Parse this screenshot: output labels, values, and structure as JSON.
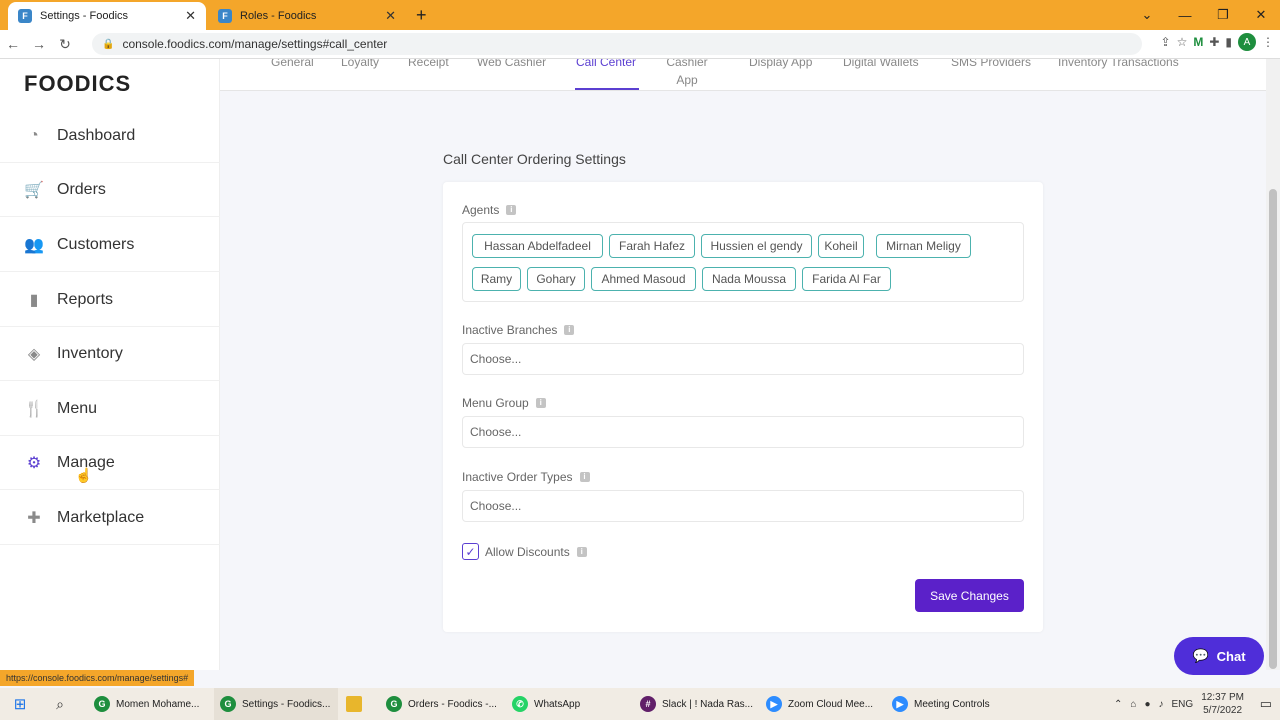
{
  "browser": {
    "tabs": [
      {
        "title": "Settings - Foodics",
        "active": true
      },
      {
        "title": "Roles - Foodics",
        "active": false
      }
    ],
    "url": "console.foodics.com/manage/settings#call_center",
    "status_url": "https://console.foodics.com/manage/settings#",
    "profile_initial": "A"
  },
  "sidebar": {
    "logo": "FOODICS",
    "items": [
      {
        "label": "Dashboard",
        "icon": "gauge-icon"
      },
      {
        "label": "Orders",
        "icon": "cart-icon"
      },
      {
        "label": "Customers",
        "icon": "users-icon"
      },
      {
        "label": "Reports",
        "icon": "bar-chart-icon"
      },
      {
        "label": "Inventory",
        "icon": "layers-icon"
      },
      {
        "label": "Menu",
        "icon": "utensils-icon"
      },
      {
        "label": "Manage",
        "icon": "gear-icon"
      },
      {
        "label": "Marketplace",
        "icon": "puzzle-icon"
      }
    ]
  },
  "topnav": {
    "tabs": [
      "General",
      "Loyalty",
      "Receipt",
      "Web Cashier",
      "Call Center",
      "Cashier App",
      "Display App",
      "Digital Wallets",
      "SMS Providers",
      "Inventory Transactions"
    ],
    "active": "Call Center"
  },
  "page": {
    "title": "Call Center Ordering Settings",
    "agents_label": "Agents",
    "agents": [
      "Hassan Abdelfadeel",
      "Farah Hafez",
      "Hussien el gendy",
      "Koheil",
      "Mirnan Meligy",
      "Ramy",
      "Gohary",
      "Ahmed Masoud",
      "Nada Moussa",
      "Farida Al Far"
    ],
    "inactive_branches_label": "Inactive Branches",
    "inactive_branches_placeholder": "Choose...",
    "menu_group_label": "Menu Group",
    "menu_group_placeholder": "Choose...",
    "inactive_order_types_label": "Inactive Order Types",
    "inactive_order_types_placeholder": "Choose...",
    "allow_discounts_label": "Allow Discounts",
    "allow_discounts_checked": true,
    "save_label": "Save Changes"
  },
  "chat": {
    "label": "Chat"
  },
  "taskbar": {
    "items": [
      "Momen Mohame...",
      "Settings - Foodics...",
      "",
      "Orders - Foodics -...",
      "WhatsApp",
      "Slack | ! Nada Ras...",
      "Zoom Cloud Mee...",
      "Meeting Controls"
    ],
    "language": "ENG",
    "time": "12:37 PM",
    "date": "5/7/2022"
  },
  "colors": {
    "accent": "#5b3fd1",
    "button": "#5b21c9",
    "chip_border": "#4cb2ae",
    "browser_frame": "#f4a62a"
  }
}
